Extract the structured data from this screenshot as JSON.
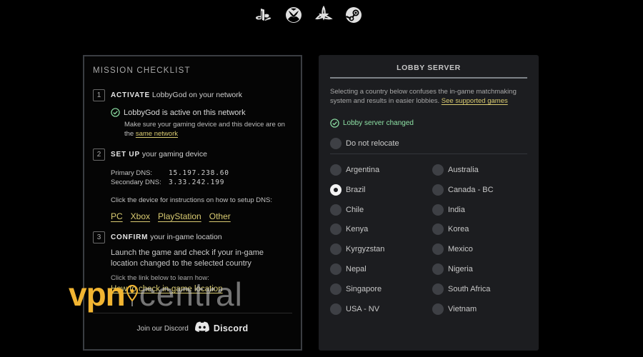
{
  "platforms": [
    "playstation-icon",
    "xbox-icon",
    "battlenet-icon",
    "steam-icon"
  ],
  "checklist": {
    "title": "MISSION CHECKLIST",
    "step1": {
      "num": "1",
      "keyword": "ACTIVATE",
      "rest": "LobbyGod on your network",
      "status": "LobbyGod is active on this network",
      "note_prefix": "Make sure your gaming device and this device are on the",
      "note_link": "same network"
    },
    "step2": {
      "num": "2",
      "keyword": "SET UP",
      "rest": "your gaming device",
      "primary_label": "Primary DNS:",
      "primary_value": "15.197.238.60",
      "secondary_label": "Secondary DNS:",
      "secondary_value": "3.33.242.199",
      "instructions": "Click the device for instructions on how to setup DNS:",
      "devices": [
        "PC",
        "Xbox",
        "PlayStation",
        "Other"
      ]
    },
    "step3": {
      "num": "3",
      "keyword": "CONFIRM",
      "rest": "your in-game location",
      "text": "Launch the game and check if your in-game location changed to the selected country",
      "learn": "Click the link below to learn how:",
      "link": "How to check in-game location"
    },
    "discord": {
      "join": "Join our Discord",
      "brand": "Discord"
    }
  },
  "watermark": {
    "vpn": "vpn",
    "central": "central"
  },
  "lobby": {
    "title": "LOBBY SERVER",
    "desc": "Selecting a country below confuses the in-game matchmaking system and results in easier lobbies.",
    "desc_link": "See supported games",
    "status": "Lobby server changed",
    "no_relocate": "Do not relocate",
    "selected": "Brazil",
    "countries": [
      "Argentina",
      "Australia",
      "Brazil",
      "Canada - BC",
      "Chile",
      "India",
      "Kenya",
      "Korea",
      "Kyrgyzstan",
      "Mexico",
      "Nepal",
      "Nigeria",
      "Singapore",
      "South Africa",
      "USA - NV",
      "Vietnam"
    ]
  },
  "colors": {
    "accent_link": "#d9cb71",
    "success": "#8de0a4",
    "watermark_orange": "#f2b532",
    "panel_bg": "#1c1d20"
  }
}
